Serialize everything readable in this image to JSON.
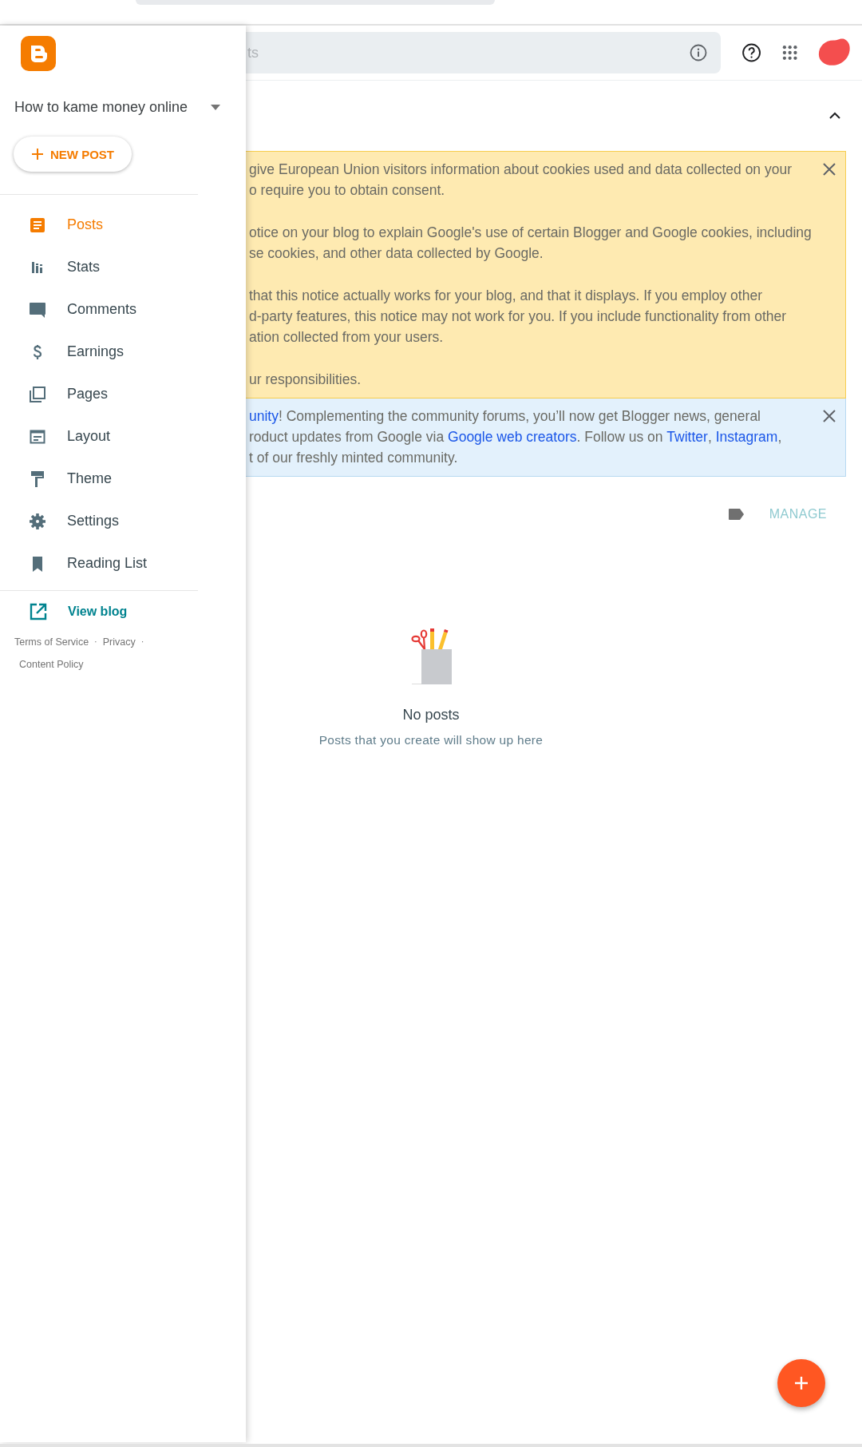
{
  "header": {
    "search": {
      "placeholder": "ts"
    }
  },
  "drawer": {
    "blog_title": "How to kame money online",
    "new_post": "NEW POST",
    "nav": [
      {
        "label": "Posts",
        "selected": true
      },
      {
        "label": "Stats",
        "selected": false
      },
      {
        "label": "Comments",
        "selected": false
      },
      {
        "label": "Earnings",
        "selected": false
      },
      {
        "label": "Pages",
        "selected": false
      },
      {
        "label": "Layout",
        "selected": false
      },
      {
        "label": "Theme",
        "selected": false
      },
      {
        "label": "Settings",
        "selected": false
      },
      {
        "label": "Reading List",
        "selected": false
      }
    ],
    "view_blog": "View blog",
    "footer": [
      {
        "label": "Terms of Service",
        "separator": "·"
      },
      {
        "label": "Privacy",
        "separator": "·"
      },
      {
        "label": "Content Policy"
      }
    ]
  },
  "notices": [
    {
      "kind": "warning",
      "paragraphs": [
        [
          [
            {
              "text": "give European Union visitors information about cookies used and data collected on your"
            }
          ],
          [
            {
              "text": "o require you to obtain consent."
            }
          ]
        ],
        [
          [
            {
              "text": "otice on your blog to explain Google's use of certain Blogger and Google cookies, including"
            }
          ],
          [
            {
              "text": "se cookies, and other data collected by Google."
            }
          ]
        ],
        [
          [
            {
              "text": "that this notice actually works for your blog, and that it displays. If you employ other"
            }
          ],
          [
            {
              "text": "d-party features, this notice may not work for you. If you include functionality from other"
            }
          ],
          [
            {
              "text": "ation collected from your users."
            }
          ]
        ],
        [
          [
            {
              "text": "ur responsibilities."
            }
          ]
        ]
      ]
    },
    {
      "kind": "info",
      "paragraphs": [
        [
          [
            {
              "text": "unity",
              "link": true
            },
            {
              "text": "! Complementing the community forums, you’ll now get Blogger news, general"
            }
          ],
          [
            {
              "text": "roduct updates from Google via "
            },
            {
              "text": "Google web creators",
              "link": true
            },
            {
              "text": ". Follow us on "
            },
            {
              "text": "Twitter",
              "link": true
            },
            {
              "text": ", "
            },
            {
              "text": "Instagram",
              "link": true
            },
            {
              "text": ","
            }
          ],
          [
            {
              "text": "t of our freshly minted community."
            }
          ]
        ]
      ]
    }
  ],
  "posts": {
    "manage": "MANAGE",
    "empty_title": "No posts",
    "empty_subtitle": "Posts that you create will show up here"
  }
}
